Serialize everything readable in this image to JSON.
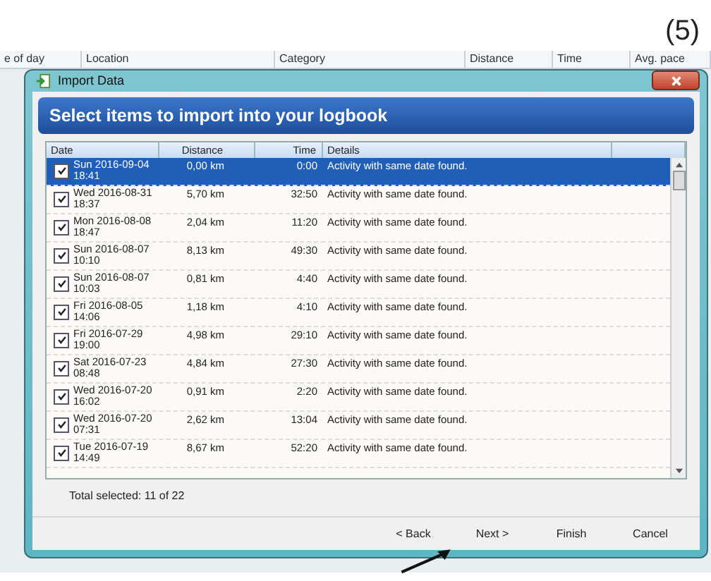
{
  "figure_label": "(5)",
  "background_app": {
    "columns": [
      "e of day",
      "Location",
      "Category",
      "Distance",
      "Time",
      "Avg. pace"
    ]
  },
  "window": {
    "title": "Import Data"
  },
  "banner": "Select items to import into your logbook",
  "table": {
    "columns": [
      "Date",
      "Distance",
      "Time",
      "Details"
    ],
    "rows": [
      {
        "date": "Sun 2016-09-04",
        "time_of_day": "18:41",
        "distance": "0,00 km",
        "time": "0:00",
        "details": "Activity with same date found.",
        "checked": true,
        "selected": true
      },
      {
        "date": "Wed 2016-08-31",
        "time_of_day": "18:37",
        "distance": "5,70 km",
        "time": "32:50",
        "details": "Activity with same date found.",
        "checked": true,
        "selected": false
      },
      {
        "date": "Mon 2016-08-08",
        "time_of_day": "18:47",
        "distance": "2,04 km",
        "time": "11:20",
        "details": "Activity with same date found.",
        "checked": true,
        "selected": false
      },
      {
        "date": "Sun 2016-08-07",
        "time_of_day": "10:10",
        "distance": "8,13 km",
        "time": "49:30",
        "details": "Activity with same date found.",
        "checked": true,
        "selected": false
      },
      {
        "date": "Sun 2016-08-07",
        "time_of_day": "10:03",
        "distance": "0,81 km",
        "time": "4:40",
        "details": "Activity with same date found.",
        "checked": true,
        "selected": false
      },
      {
        "date": "Fri 2016-08-05",
        "time_of_day": "14:06",
        "distance": "1,18 km",
        "time": "4:10",
        "details": "Activity with same date found.",
        "checked": true,
        "selected": false
      },
      {
        "date": "Fri 2016-07-29",
        "time_of_day": "19:00",
        "distance": "4,98 km",
        "time": "29:10",
        "details": "Activity with same date found.",
        "checked": true,
        "selected": false
      },
      {
        "date": "Sat 2016-07-23",
        "time_of_day": "08:48",
        "distance": "4,84 km",
        "time": "27:30",
        "details": "Activity with same date found.",
        "checked": true,
        "selected": false
      },
      {
        "date": "Wed 2016-07-20",
        "time_of_day": "16:02",
        "distance": "0,91 km",
        "time": "2:20",
        "details": "Activity with same date found.",
        "checked": true,
        "selected": false
      },
      {
        "date": "Wed 2016-07-20",
        "time_of_day": "07:31",
        "distance": "2,62 km",
        "time": "13:04",
        "details": "Activity with same date found.",
        "checked": true,
        "selected": false
      },
      {
        "date": "Tue 2016-07-19",
        "time_of_day": "14:49",
        "distance": "8,67 km",
        "time": "52:20",
        "details": "Activity with same date found.",
        "checked": true,
        "selected": false
      }
    ]
  },
  "total_selected": "Total selected: 11 of 22",
  "buttons": [
    "< Back",
    "Next >",
    "Finish",
    "Cancel"
  ]
}
